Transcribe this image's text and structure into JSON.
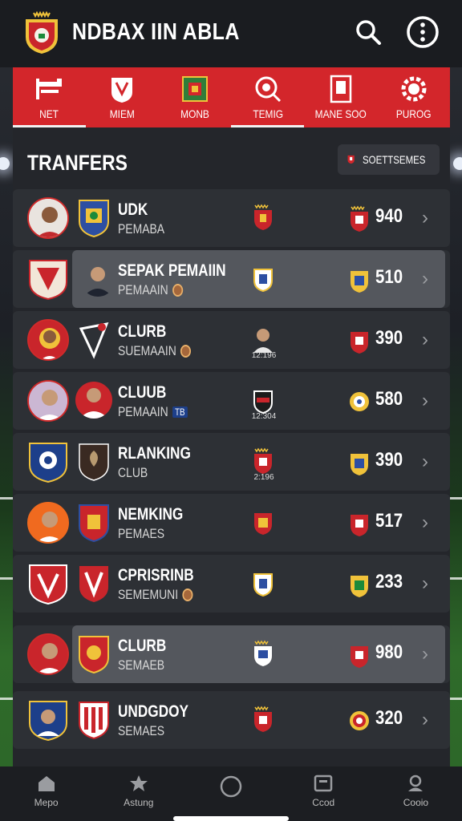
{
  "app": {
    "title": "NDBAX IIN ABLA"
  },
  "header": {
    "search_icon": "search-icon",
    "menu_icon": "more-vertical-icon"
  },
  "colors": {
    "accent": "#d3262b",
    "background": "#1a1c20",
    "row": "#2d3035",
    "highlight": "#54575d"
  },
  "tabs": [
    {
      "label": "NET",
      "icon": "net-icon",
      "active": true
    },
    {
      "label": "MIEM",
      "icon": "shirt-icon",
      "active": false
    },
    {
      "label": "MONB",
      "icon": "badge-icon",
      "active": false
    },
    {
      "label": "TEMIG",
      "icon": "search-icon",
      "active": true
    },
    {
      "label": "MANE SOO",
      "icon": "card-icon",
      "active": false
    },
    {
      "label": "PUROG",
      "icon": "gear-icon",
      "active": false
    }
  ],
  "section": {
    "title": "TRANFERS",
    "sort_label": "SOETTSEMES"
  },
  "rows": [
    {
      "name": "UDK",
      "sub": "PEMABA",
      "sub_badge": "",
      "mid_text": "",
      "value": "940",
      "highlight": false
    },
    {
      "name": "SEPAK PEMAIIN",
      "sub": "PEMAAIN",
      "sub_badge": "ball",
      "mid_text": "",
      "value": "510",
      "highlight": true
    },
    {
      "name": "CLURB",
      "sub": "SUEMAAIN",
      "sub_badge": "ball",
      "mid_text": "12:196",
      "value": "390",
      "highlight": false
    },
    {
      "name": "CLUUB",
      "sub": "PEMAAIN",
      "sub_badge": "tag",
      "sub_tag": "TB",
      "mid_text": "12:304",
      "value": "580",
      "highlight": false
    },
    {
      "name": "RLANKING",
      "sub": "CLUB",
      "sub_badge": "",
      "mid_text": "2:196",
      "value": "390",
      "highlight": false
    },
    {
      "name": "NEMKING",
      "sub": "PEMAES",
      "sub_badge": "",
      "mid_text": "",
      "value": "517",
      "highlight": false
    },
    {
      "name": "CPRISRINB",
      "sub": "SEMEMUNI",
      "sub_badge": "ball",
      "mid_text": "",
      "value": "233",
      "highlight": false
    },
    {
      "name": "CLURB",
      "sub": "SEMAEB",
      "sub_badge": "",
      "mid_text": "",
      "value": "980",
      "highlight": true
    },
    {
      "name": "UNDGDOY",
      "sub": "SEMAES",
      "sub_badge": "",
      "mid_text": "",
      "value": "320",
      "highlight": false
    }
  ],
  "bottom_nav": [
    {
      "label": "Mepo",
      "icon": "home-icon"
    },
    {
      "label": "Astung",
      "icon": "star-icon"
    },
    {
      "label": "",
      "icon": "circle-icon"
    },
    {
      "label": "Ccod",
      "icon": "square-icon"
    },
    {
      "label": "Cooio",
      "icon": "profile-icon"
    }
  ]
}
